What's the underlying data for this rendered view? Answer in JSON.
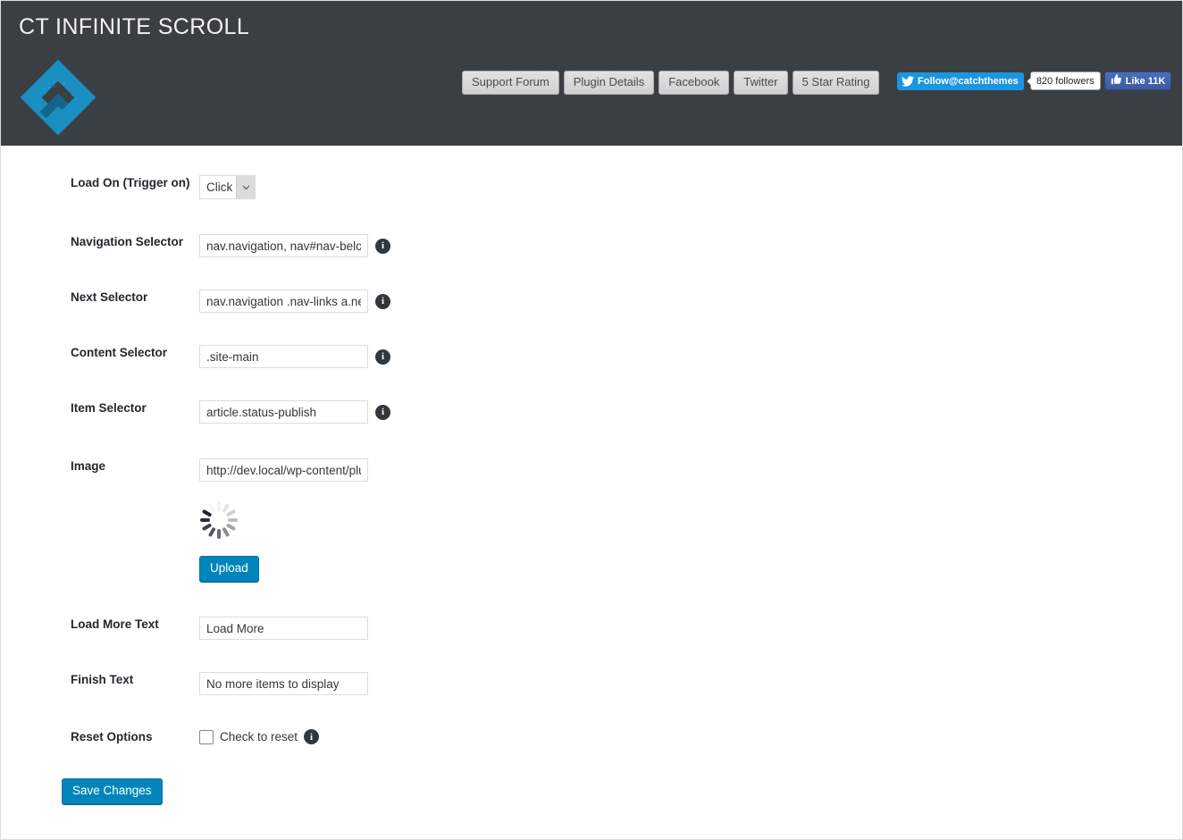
{
  "header": {
    "title": "CT INFINITE SCROLL",
    "logo_alt": "catch-themes-logo",
    "links": [
      {
        "label": "Support Forum"
      },
      {
        "label": "Plugin Details"
      },
      {
        "label": "Facebook"
      },
      {
        "label": "Twitter"
      },
      {
        "label": "5 Star Rating"
      }
    ],
    "social": {
      "twitter_follow": "Follow@catchthemes",
      "twitter_count": "820  followers",
      "facebook_like": "Like 11K"
    },
    "bg_color": "#3a3f44",
    "accent_color": "#0085ba"
  },
  "form": {
    "rows": [
      {
        "label": "Load On (Trigger on)",
        "type": "select",
        "value": "Click",
        "info": false
      },
      {
        "label": "Navigation Selector",
        "type": "text",
        "value": "nav.navigation, nav#nav-below",
        "info": true
      },
      {
        "label": "Next Selector",
        "type": "text",
        "value": "nav.navigation .nav-links a.next",
        "info": true
      },
      {
        "label": "Content Selector",
        "type": "text",
        "value": ".site-main",
        "info": true
      },
      {
        "label": "Item Selector",
        "type": "text",
        "value": "article.status-publish",
        "info": true
      },
      {
        "label": "Image",
        "type": "image",
        "value": "http://dev.local/wp-content/plugins/ct-infinite-scroll/images/loader.gif",
        "info": false
      },
      {
        "label": "Load More Text",
        "type": "text",
        "value": "Load More",
        "info": false
      },
      {
        "label": "Finish Text",
        "type": "text",
        "value": "No more items to display",
        "info": false
      },
      {
        "label": "Reset Options",
        "type": "checkbox",
        "value": "Check to reset",
        "info": true
      }
    ],
    "upload_label": "Upload",
    "submit_label": "Save Changes",
    "loader_icon": "spinner-icon",
    "info_icon": "info-icon"
  }
}
